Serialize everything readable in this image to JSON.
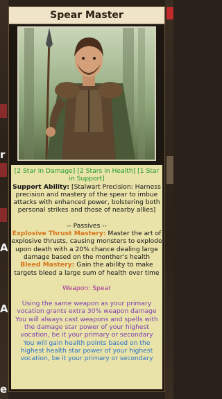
{
  "title": "Spear Master",
  "stars_line": "[2 Star in Damage] [2 Stars in Health] [1 Star in Support]",
  "support": {
    "label": "Support Ability:",
    "text": "[Stalwart Precision: Harness precision and mastery of the spear to imbue attacks with enhanced power, bolstering both personal strikes and those of nearby allies]"
  },
  "passives_header": "-- Passives --",
  "passives": [
    {
      "name": "Explosive Thrust Mastery:",
      "text": "Master the art of explosive thrusts, causing monsters to explode upon death with a 20% chance dealing large damage based on the monther's health"
    },
    {
      "name": "Bleed Mastery:",
      "text": "Gain the ability to make targets bleed a large sum of health over time"
    }
  ],
  "weapon_line": "Weapon: Spear",
  "bonus_primary": "Using the same weapon as your primary vocation grants extra 30% weapon damage",
  "bonus_damage": "You will always cast weapons and spells with the damage star power of your highest vocation, be it your primary or secondary",
  "bonus_health": "You will gain health points based on the highest health star power of your highest vocation, be it your primary or secondary",
  "edge_letters": [
    "r",
    "A",
    "A",
    "e"
  ],
  "colors": {
    "title_bg": "#efe4c8",
    "desc_bg": "#e9e2a9",
    "stars": "#1f9a2a",
    "passive_name": "#d5741a",
    "weapon": "#a32b96",
    "bonus_primary": "#7a3fb0",
    "bonus_health": "#2a74c9"
  },
  "portrait_subject": "spear-warrior-portrait"
}
